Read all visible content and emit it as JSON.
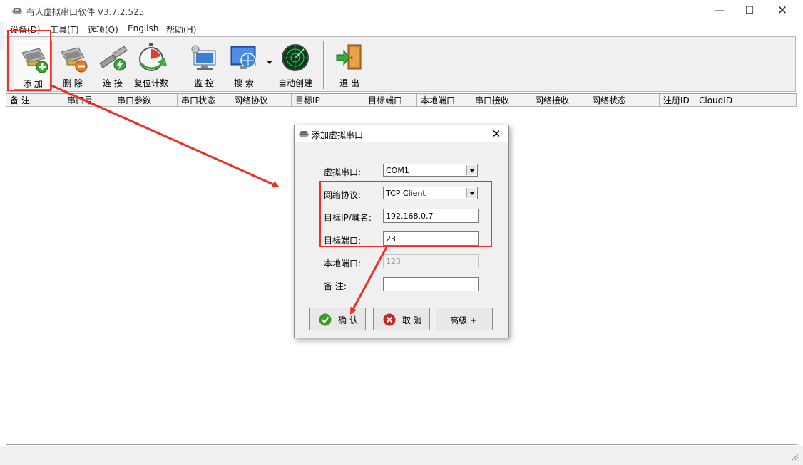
{
  "window": {
    "title": "有人虚拟串口软件 V3.7.2.525",
    "minimize_glyph": "—",
    "maximize_glyph": "☐",
    "close_glyph": "✕"
  },
  "menu": [
    "设备(D)",
    "工具(T)",
    "选项(O)",
    "English",
    "帮助(H)"
  ],
  "toolbar": {
    "add": "添 加",
    "delete": "删 除",
    "connect": "连 接",
    "reset_count": "复位计数",
    "monitor": "监 控",
    "search": "搜 索",
    "auto_create": "自动创建",
    "exit": "退 出"
  },
  "columns": [
    "备 注",
    "串口号",
    "串口参数",
    "串口状态",
    "网络协议",
    "目标IP",
    "目标端口",
    "本地端口",
    "串口接收",
    "网络接收",
    "网络状态",
    "注册ID",
    "CloudID"
  ],
  "dialog": {
    "title": "添加虚拟串口",
    "close_glyph": "✕",
    "virtual_port_label": "虚拟串口:",
    "virtual_port_value": "COM1",
    "protocol_label": "网络协议:",
    "protocol_value": "TCP Client",
    "target_ip_label": "目标IP/域名:",
    "target_ip_value": "192.168.0.7",
    "target_port_label": "目标端口:",
    "target_port_value": "23",
    "local_port_label": "本地端口:",
    "local_port_value": "123",
    "remark_label": "备  注:",
    "remark_value": "",
    "confirm_label": "确 认",
    "cancel_label": "取 消",
    "advanced_label": "高级 +"
  },
  "colors": {
    "annotation_red": "#e8312a",
    "toolbar_bg": "#f0f0f0",
    "confirm_green": "#3a9a2a",
    "cancel_red": "#c8261f"
  }
}
